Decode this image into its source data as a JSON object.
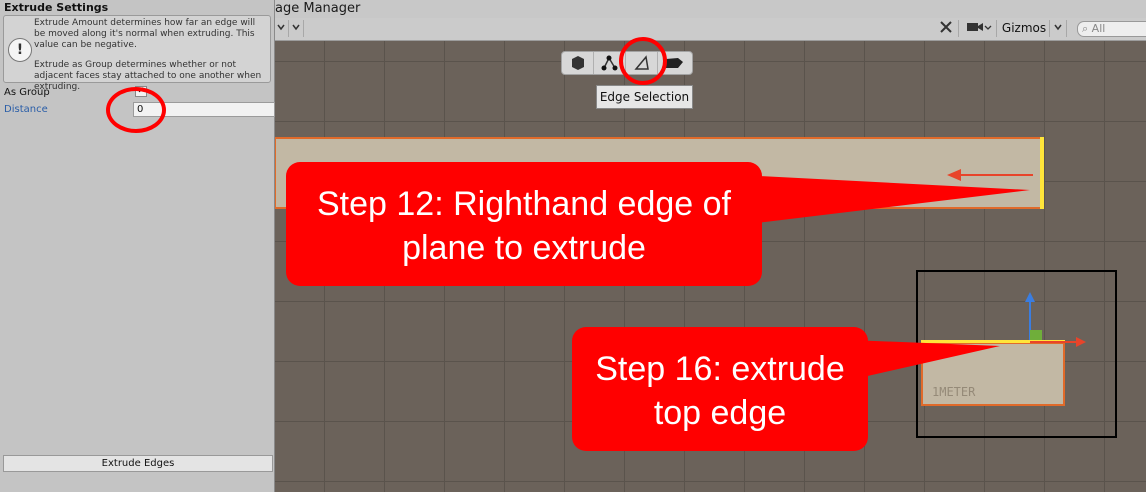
{
  "window": {
    "title_fragment": "age Manager"
  },
  "toolbar": {
    "gizmos_label": "Gizmos",
    "search_placeholder": "All",
    "icons": [
      "tools-icon",
      "camera-icon",
      "chevron-down-icon",
      "search-icon"
    ]
  },
  "panel": {
    "title": "Extrude Settings",
    "help_text_1": "Extrude Amount determines how far an edge will be moved along it's normal when extruding.  This value can be negative.",
    "help_text_2": "Extrude as Group determines whether or not adjacent faces stay attached to one another when extruding.",
    "as_group_label": "As Group",
    "distance_label": "Distance",
    "distance_value": "0",
    "extrude_button_label": "Extrude Edges"
  },
  "selection_modes": {
    "items": [
      "object-mode-icon",
      "vertex-mode-icon",
      "edge-mode-icon",
      "face-mode-icon"
    ],
    "active": "edge-mode-icon",
    "tooltip": "Edge Selection"
  },
  "scene": {
    "plane2_label": "1METER"
  },
  "callouts": {
    "step12_line1": "Step 12:  Righthand edge of",
    "step12_line2": "plane to extrude",
    "step16_line1": "Step 16: extrude",
    "step16_line2": "top edge"
  },
  "colors": {
    "annotation_red": "#ff0000",
    "selected_edge": "#ffe53a",
    "plane_outline": "#e06a2a"
  }
}
